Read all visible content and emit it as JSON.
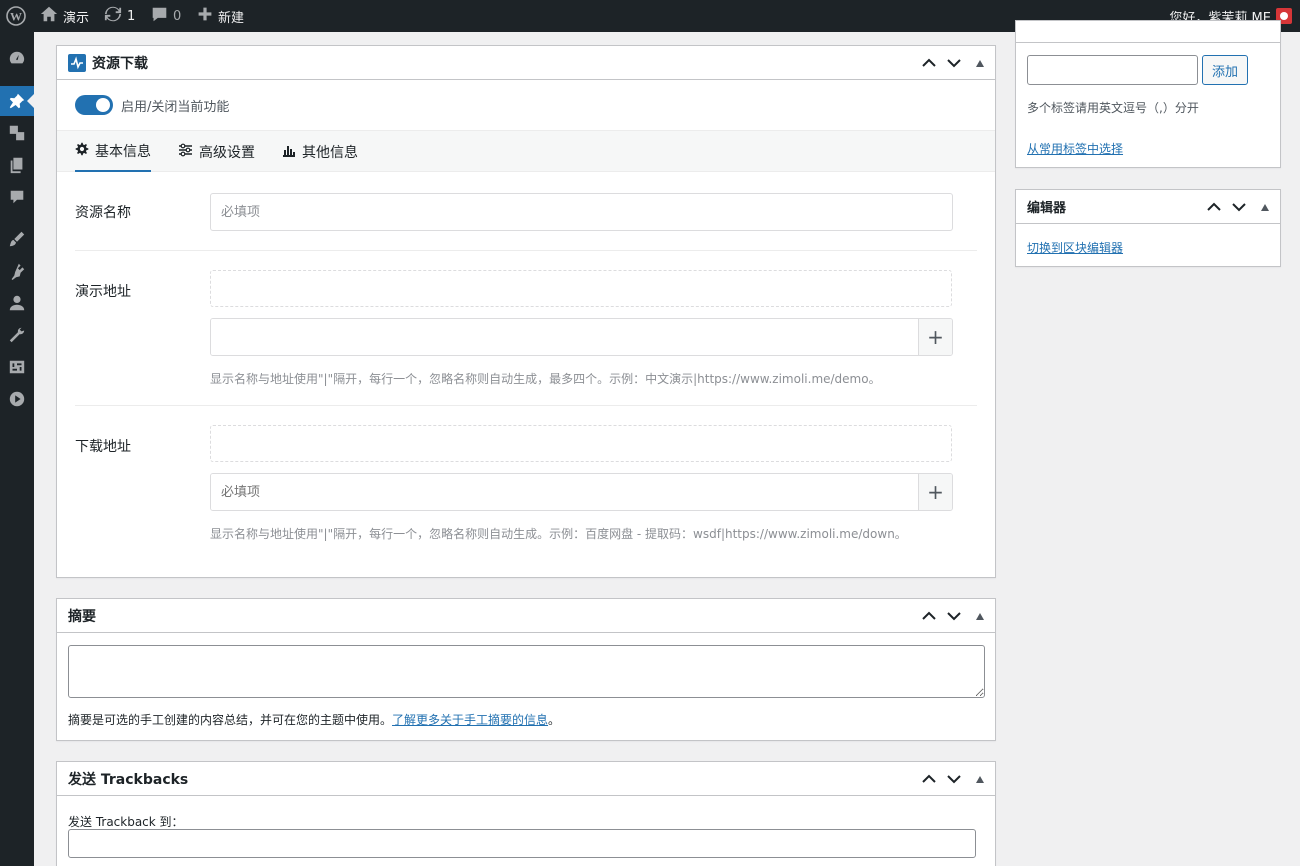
{
  "adminbar": {
    "site_name": "演示",
    "updates_count": "1",
    "comments_count": "0",
    "new_label": "新建",
    "greeting": "您好，紫茉莉.ME"
  },
  "metabox_download": {
    "title": "资源下载",
    "toggle_label": "启用/关闭当前功能",
    "toggle_on": true,
    "tabs": [
      {
        "label": "基本信息",
        "icon": "gear-icon",
        "active": true
      },
      {
        "label": "高级设置",
        "icon": "sliders-icon",
        "active": false
      },
      {
        "label": "其他信息",
        "icon": "bar-chart-icon",
        "active": false
      }
    ],
    "resource_name": {
      "label": "资源名称",
      "placeholder": "必填项"
    },
    "demo_url": {
      "label": "演示地址",
      "placeholder": "",
      "add_label": "+",
      "help": "显示名称与地址使用\"|\"隔开，每行一个，忽略名称则自动生成，最多四个。示例：中文演示|https://www.zimoli.me/demo。"
    },
    "download_url": {
      "label": "下载地址",
      "placeholder": "必填项",
      "add_label": "+",
      "help": "显示名称与地址使用\"|\"隔开，每行一个，忽略名称则自动生成。示例：百度网盘 - 提取码：wsdf|https://www.zimoli.me/down。"
    }
  },
  "metabox_excerpt": {
    "title": "摘要",
    "help_prefix": "摘要是可选的手工创建的内容总结，并可在您的主题中使用。",
    "help_link": "了解更多关于手工摘要的信息",
    "help_suffix": "。"
  },
  "metabox_trackbacks": {
    "title": "发送 Trackbacks",
    "field_label": "发送 Trackback 到："
  },
  "sidebar_tags": {
    "add_button": "添加",
    "help": "多个标签请用英文逗号（,）分开",
    "choose_link": "从常用标签中选择"
  },
  "sidebar_editor": {
    "title": "编辑器",
    "switch_link": "切换到区块编辑器"
  },
  "colors": {
    "accent": "#2271b1",
    "adminbar": "#1d2327"
  }
}
